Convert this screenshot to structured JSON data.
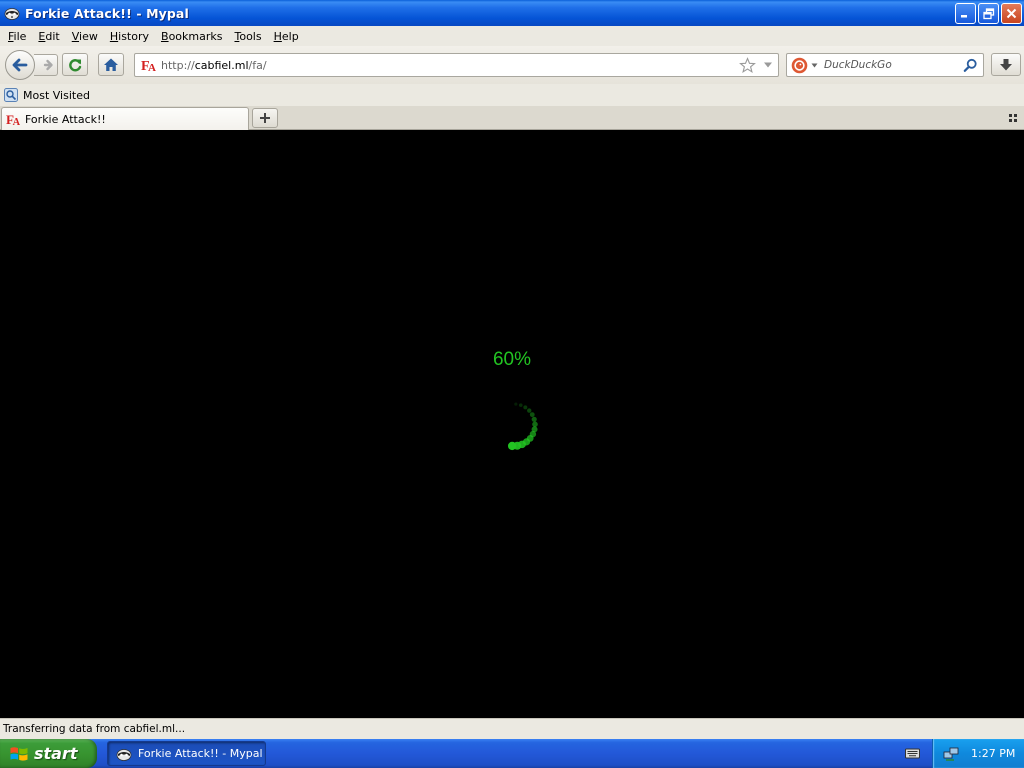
{
  "window": {
    "title": "Forkie Attack!! - Mypal"
  },
  "menubar": {
    "items": [
      {
        "label": "File",
        "accel": "F",
        "rest": "ile"
      },
      {
        "label": "Edit",
        "accel": "E",
        "rest": "dit"
      },
      {
        "label": "View",
        "accel": "V",
        "rest": "iew"
      },
      {
        "label": "History",
        "accel": "H",
        "rest": "istory"
      },
      {
        "label": "Bookmarks",
        "accel": "B",
        "rest": "ookmarks"
      },
      {
        "label": "Tools",
        "accel": "T",
        "rest": "ools"
      },
      {
        "label": "Help",
        "accel": "H",
        "rest": "elp"
      }
    ]
  },
  "navbar": {
    "url_prefix": "http://",
    "url_host": "cabfiel.ml",
    "url_path": "/fa/",
    "search": {
      "placeholder": "DuckDuckGo"
    }
  },
  "bookmarks": {
    "most_visited": "Most Visited"
  },
  "tabs": [
    {
      "title": "Forkie Attack!!",
      "active": true
    }
  ],
  "content": {
    "loading_percent": "60%",
    "progress": 0.6,
    "accent_color": "#22c422"
  },
  "statusbar": {
    "text": "Transferring data from cabfiel.ml..."
  },
  "taskbar": {
    "start_label": "start",
    "task_title": "Forkie Attack!! - Mypal",
    "clock": "1:27 PM"
  },
  "icons": {
    "app": "raccoon-app-icon",
    "site": "fa-site-icon",
    "back": "back-arrow-icon",
    "forward": "forward-arrow-icon",
    "reload": "reload-icon",
    "home": "home-icon",
    "bookmark": "star-icon",
    "search_engine": "duckduckgo-icon",
    "downloads": "download-arrow-icon",
    "tray_network": "network-icon",
    "keyboard": "keyboard-icon"
  }
}
